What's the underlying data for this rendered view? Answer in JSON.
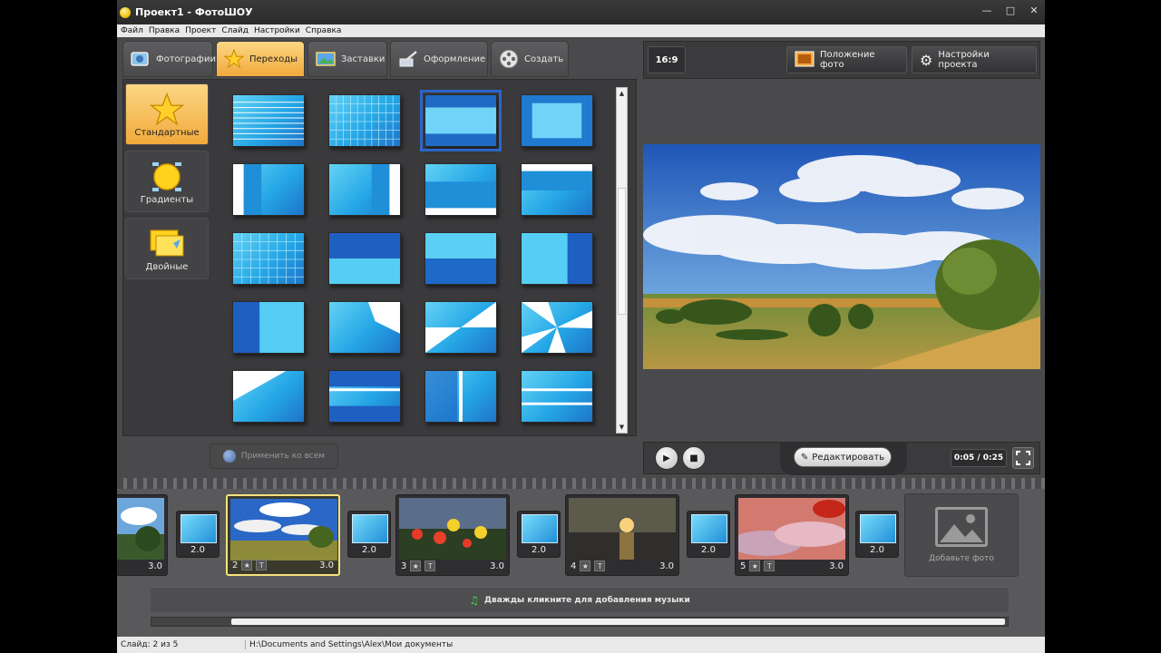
{
  "window": {
    "title": "Проект1 - ФотоШОУ"
  },
  "menu": [
    "Файл",
    "Правка",
    "Проект",
    "Слайд",
    "Настройки",
    "Справка"
  ],
  "tabs": [
    {
      "label": "Фотографии",
      "icon": "photos-icon",
      "active": false
    },
    {
      "label": "Переходы",
      "icon": "star-icon",
      "active": true
    },
    {
      "label": "Заставки",
      "icon": "picture-icon",
      "active": false
    },
    {
      "label": "Оформление",
      "icon": "brush-icon",
      "active": false
    },
    {
      "label": "Создать",
      "icon": "film-reel-icon",
      "active": false
    }
  ],
  "categories": [
    {
      "label": "Стандартные",
      "icon": "star-icon",
      "active": true
    },
    {
      "label": "Градиенты",
      "icon": "gradient-icon",
      "active": false
    },
    {
      "label": "Двойные",
      "icon": "double-icon",
      "active": false
    }
  ],
  "apply_all": "Применить ко всем",
  "toolbar": {
    "ratio": "16:9",
    "photo_position": "Положение фото",
    "project_settings": "Настройки проекта"
  },
  "player": {
    "edit": "Редактировать",
    "time": "0:05 / 0:25"
  },
  "slides": [
    {
      "num": "",
      "duration": "3.0"
    },
    {
      "num": "2",
      "duration": "3.0"
    },
    {
      "num": "3",
      "duration": "3.0"
    },
    {
      "num": "4",
      "duration": "3.0"
    },
    {
      "num": "5",
      "duration": "3.0"
    }
  ],
  "transitions": [
    "2.0",
    "2.0",
    "2.0",
    "2.0",
    "2.0"
  ],
  "add_photo": "Добавьте фото",
  "music_hint": "Дважды кликните для добавления музыки",
  "status": {
    "slide": "Слайд: 2 из 5",
    "path": "H:\\Documents and Settings\\Alex\\Мои документы"
  },
  "selected_transition": 3,
  "colors": {
    "accent": "#f2a93c",
    "selection": "#2b66c8",
    "slide_selected": "#f6e37a"
  }
}
